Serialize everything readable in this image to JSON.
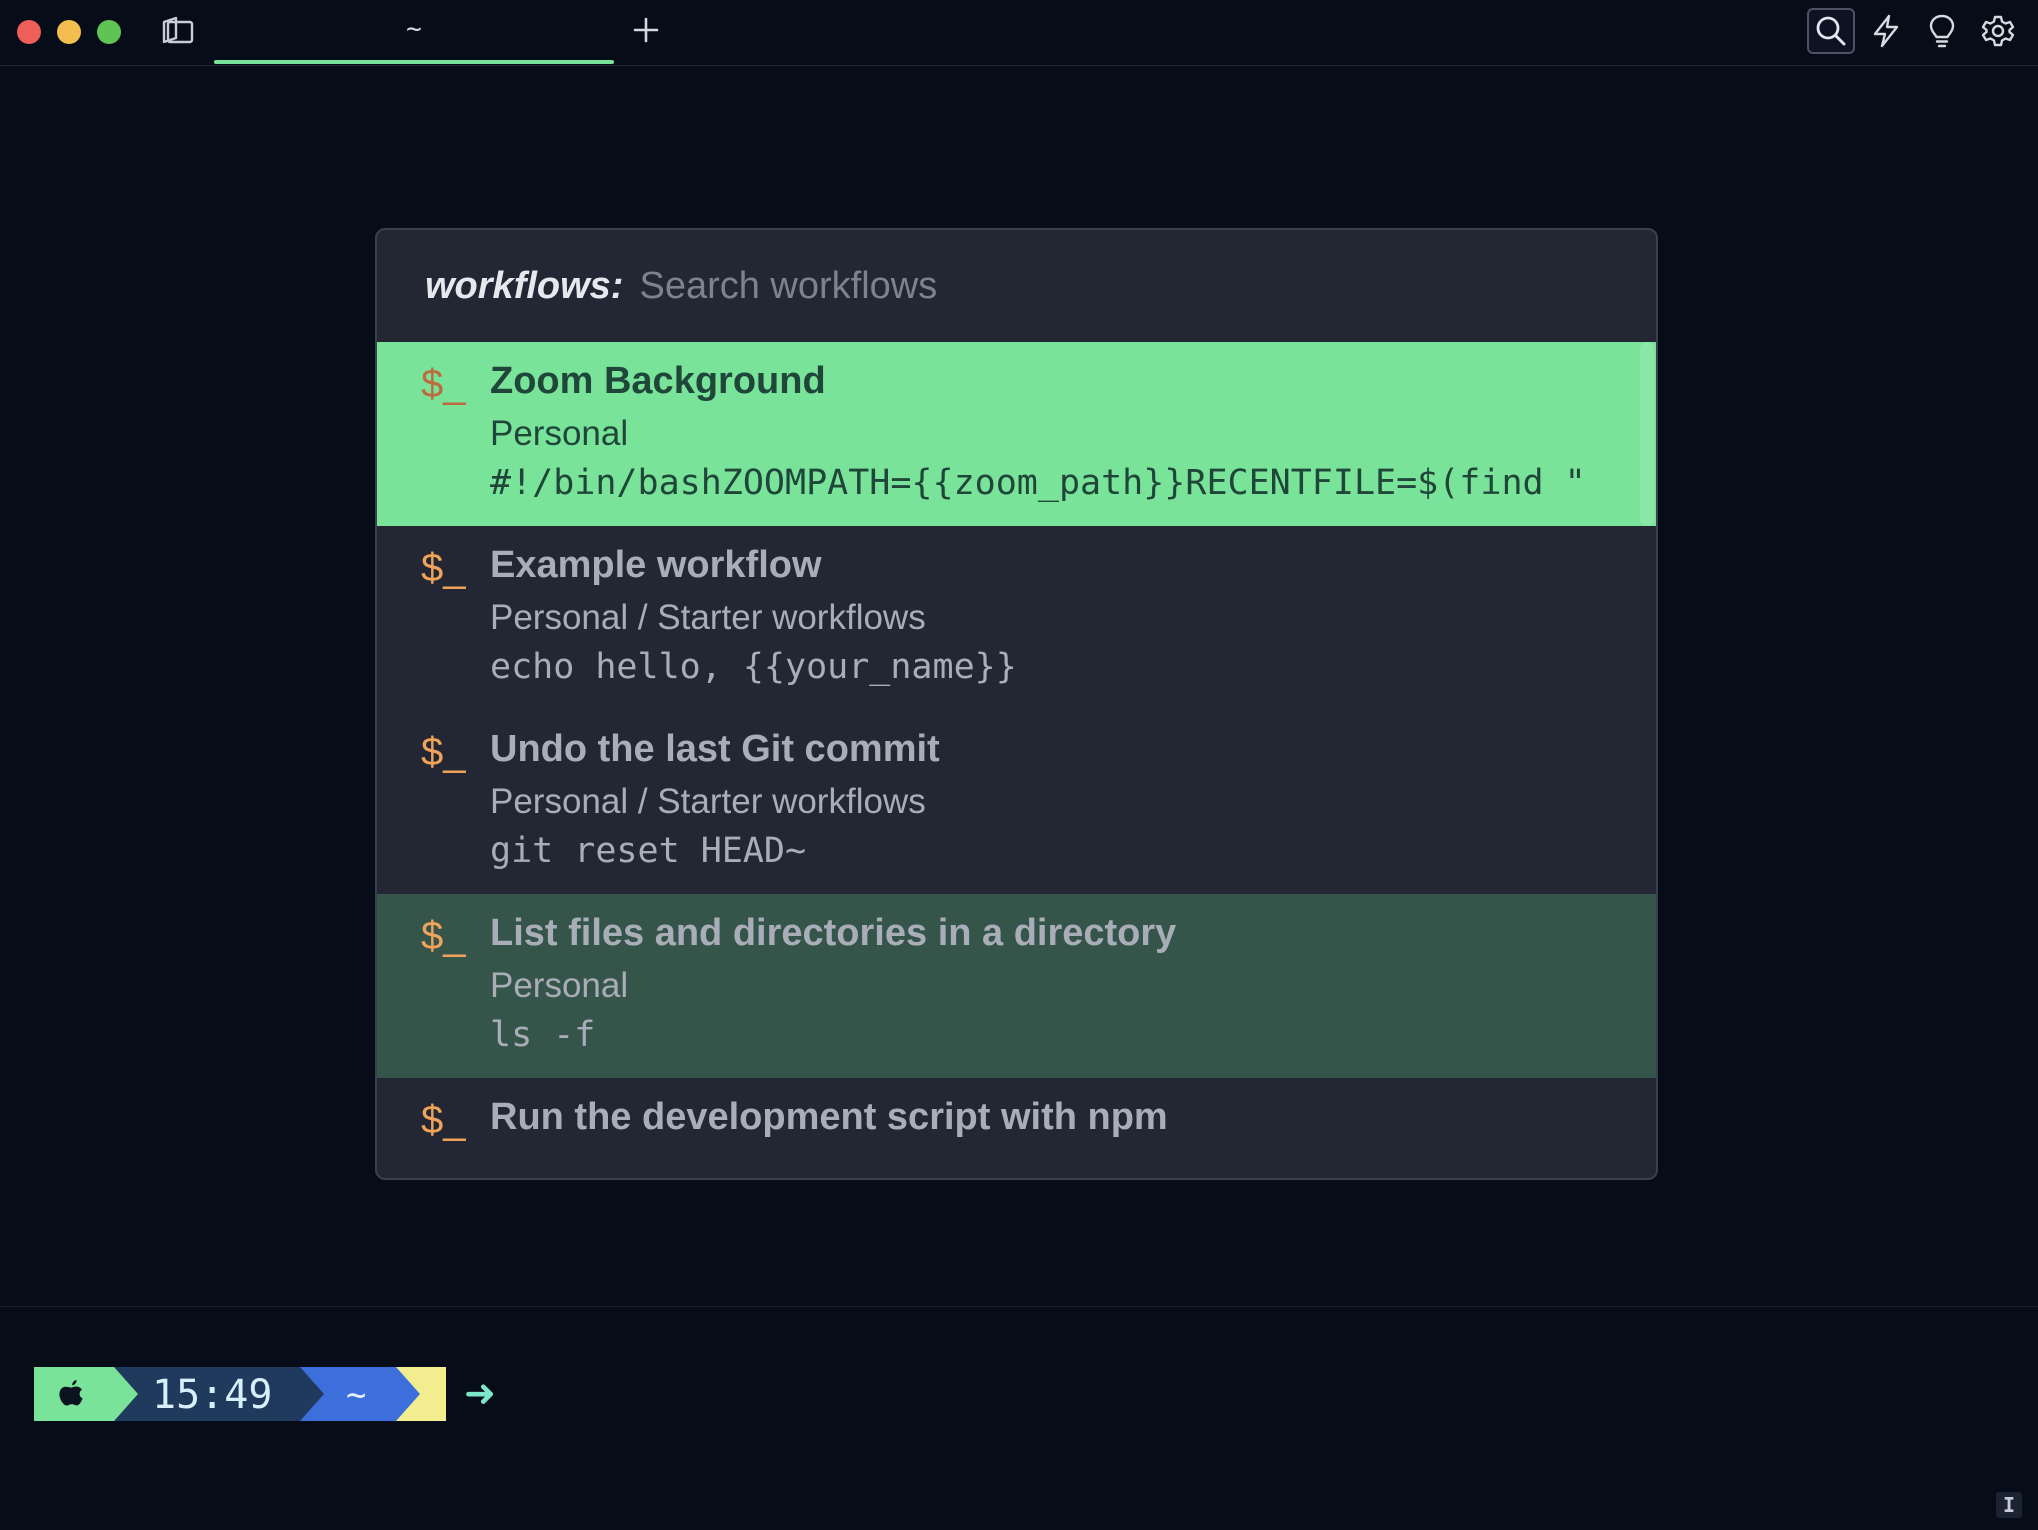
{
  "window": {
    "tab_title": "~"
  },
  "toolbar": {
    "search_icon": "search-icon",
    "bolt_icon": "bolt-icon",
    "bulb_icon": "lightbulb-icon",
    "gear_icon": "gear-icon"
  },
  "palette": {
    "prefix": "workflows:",
    "search_placeholder": "Search workflows",
    "search_value": "",
    "icon_glyph": "$_",
    "items": [
      {
        "title": "Zoom Background",
        "folder": "Personal",
        "command": "#!/bin/bashZOOMPATH={{zoom_path}}RECENTFILE=$(find \"",
        "state": "selected"
      },
      {
        "title": "Example workflow",
        "folder": "Personal / Starter workflows",
        "command": "echo hello, {{your_name}}",
        "state": "normal"
      },
      {
        "title": "Undo the last Git commit",
        "folder": "Personal / Starter workflows",
        "command": "git reset HEAD~",
        "state": "normal"
      },
      {
        "title": "List files and directories in a directory",
        "folder": "Personal",
        "command": "ls -f",
        "state": "hovered"
      },
      {
        "title": "Run the development script with npm",
        "folder": "",
        "command": "",
        "state": "normal"
      }
    ]
  },
  "prompt": {
    "time": "15:49",
    "directory": "~",
    "arrow": "➜"
  },
  "status": {
    "cursor_label": "I"
  },
  "colors": {
    "background": "#060c18",
    "accent_green": "#79e39a",
    "palette_bg": "#232733",
    "hover_row": "#35554b",
    "icon_orange": "#f0a35a",
    "prompt_blue": "#3d6fdc",
    "prompt_yellow": "#f2ed8f"
  }
}
